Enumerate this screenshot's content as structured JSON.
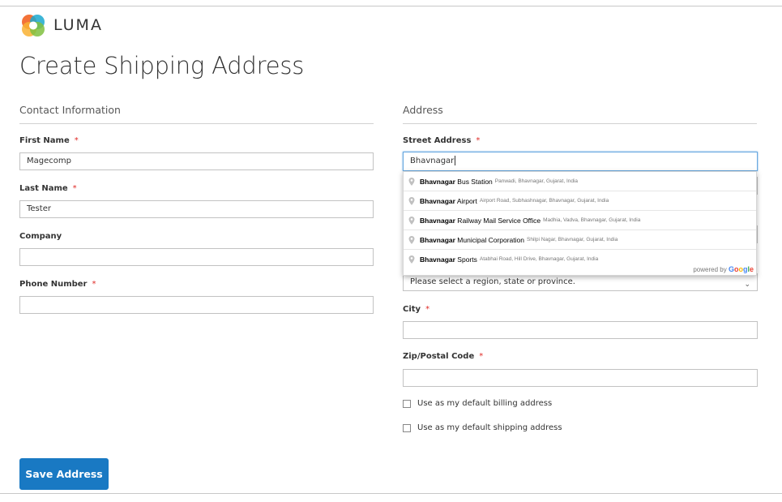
{
  "brand": {
    "name": "LUMA"
  },
  "page": {
    "title": "Create Shipping Address"
  },
  "contact": {
    "legend": "Contact Information",
    "first_name_label": "First Name",
    "first_name_value": "Magecomp",
    "last_name_label": "Last Name",
    "last_name_value": "Tester",
    "company_label": "Company",
    "company_value": "",
    "phone_label": "Phone Number",
    "phone_value": "",
    "required_mark": "*"
  },
  "address": {
    "legend": "Address",
    "street_label": "Street Address",
    "street_value": "Bhavnagar",
    "region_placeholder": "Please select a region, state or province.",
    "city_label": "City",
    "city_value": "",
    "zip_label": "Zip/Postal Code",
    "zip_value": "",
    "default_billing_label": "Use as my default billing address",
    "default_shipping_label": "Use as my default shipping address"
  },
  "autocomplete": {
    "suggestions": [
      {
        "match": "Bhavnagar",
        "rest": " Bus Station",
        "secondary": "Panwadi, Bhavnagar, Gujarat, India"
      },
      {
        "match": "Bhavnagar",
        "rest": " Airport",
        "secondary": "Airport Road, Subhashnagar, Bhavnagar, Gujarat, India"
      },
      {
        "match": "Bhavnagar",
        "rest": " Railway Mail Service Office",
        "secondary": "Madhia, Vadva, Bhavnagar, Gujarat, India"
      },
      {
        "match": "Bhavnagar",
        "rest": " Municipal Corporation",
        "secondary": "Shilpi Nagar, Bhavnagar, Gujarat, India"
      },
      {
        "match": "Bhavnagar",
        "rest": " Sports",
        "secondary": "Atabhai Road, Hill Drive, Bhavnagar, Gujarat, India"
      }
    ],
    "powered_by": "powered by",
    "google_letters": [
      "G",
      "o",
      "o",
      "g",
      "l",
      "e"
    ]
  },
  "actions": {
    "save_label": "Save Address"
  },
  "colors": {
    "primary": "#1979c3",
    "required": "#e02b27",
    "focus": "#68a8e0"
  }
}
